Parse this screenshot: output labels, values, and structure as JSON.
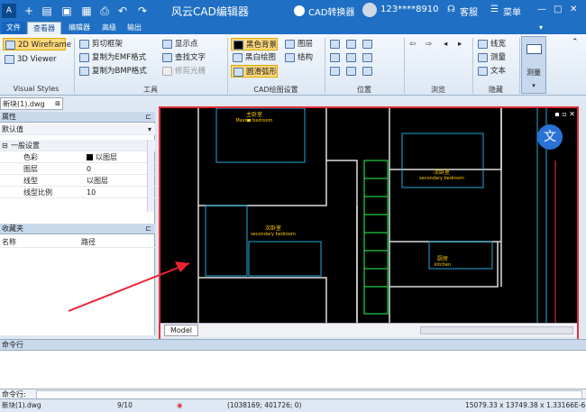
{
  "titlebar": {
    "title": "风云CAD编辑器",
    "converter": "CAD转换器",
    "user": "123****8910",
    "service": "客服",
    "menu": "菜单"
  },
  "menutabs": [
    "文件",
    "查看器",
    "编辑器",
    "高级",
    "输出"
  ],
  "ribbon": {
    "visual_styles": {
      "wireframe": "2D Wireframe",
      "viewer3d": "3D Viewer",
      "label": "Visual Styles"
    },
    "tools": {
      "clip": "剪切框架",
      "emf": "复制为EMF格式",
      "bmp": "复制为BMP格式",
      "showpoints": "显示点",
      "findtext": "查找文字",
      "trim_raster": "修剪光栅",
      "label": "工具"
    },
    "cad_settings": {
      "black_bg": "黑色背景",
      "bw_draw": "黑白绘图",
      "smooth_arc": "圆滑弧形",
      "layers": "图层",
      "structure": "结构",
      "label": "CAD绘图设置"
    },
    "position": {
      "label": "位置"
    },
    "browse": {
      "label": "浏览"
    },
    "hide": {
      "linewidth": "线宽",
      "measure": "测量",
      "text": "文本",
      "label": "隐藏"
    },
    "measure_big": "测量"
  },
  "doc_tab": "新块(1).dwg",
  "properties": {
    "header": "属性",
    "dropdown": "默认值",
    "group": "一般设置",
    "rows": [
      {
        "key": "色彩",
        "value": "以图层"
      },
      {
        "key": "图层",
        "value": "0"
      },
      {
        "key": "线型",
        "value": "以图层"
      },
      {
        "key": "线型比例",
        "value": "10"
      }
    ]
  },
  "favorites": {
    "header": "收藏夹",
    "col_name": "名称",
    "col_path": "路径"
  },
  "drawing": {
    "rooms": [
      {
        "cn": "主卧室",
        "en": "Master bedroom"
      },
      {
        "cn": "次卧室",
        "en": "secondary bedroom"
      },
      {
        "cn": "次卧室",
        "en": "secondary bedroom"
      },
      {
        "cn": "厨房",
        "en": "kitchen"
      }
    ]
  },
  "model_tab": "Model",
  "command": {
    "header": "命令行",
    "prompt": "命令行:"
  },
  "status": {
    "file": "新块(1).dwg",
    "page": "9/10",
    "coords": "(1038169; 401726; 0)",
    "right": "15079.33 x 13749.38 x 1.33166E-6"
  }
}
